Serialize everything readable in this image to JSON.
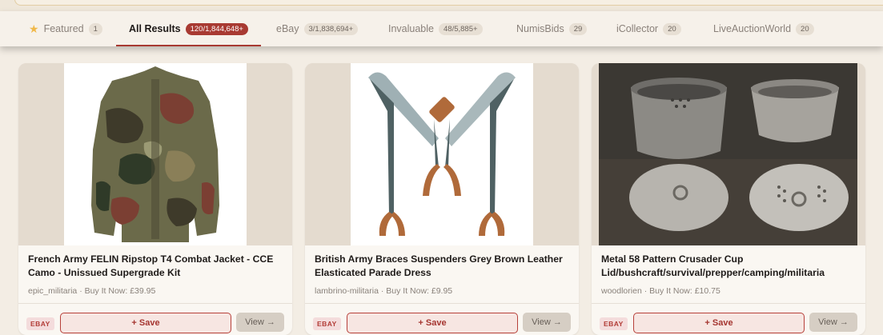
{
  "tabs": [
    {
      "label": "Featured",
      "count": "1",
      "active": false,
      "icon": "star-icon"
    },
    {
      "label": "All Results",
      "count": "120/1,844,648+",
      "active": true
    },
    {
      "label": "eBay",
      "count": "3/1,838,694+",
      "active": false
    },
    {
      "label": "Invaluable",
      "count": "48/5,885+",
      "active": false
    },
    {
      "label": "NumisBids",
      "count": "29",
      "active": false
    },
    {
      "label": "iCollector",
      "count": "20",
      "active": false
    },
    {
      "label": "LiveAuctionWorld",
      "count": "20",
      "active": false
    }
  ],
  "listings": [
    {
      "title": "French Army FELIN Ripstop T4 Combat Jacket - CCE Camo - Unissued Supergrade Kit",
      "meta": "epic_militaria · Buy It Now: £39.95",
      "source": "EBAY",
      "save_label": "+ Save",
      "view_label": "View →",
      "image": "camo-jacket-image"
    },
    {
      "title": "British Army Braces Suspenders Grey Brown Leather Elasticated Parade Dress",
      "meta": "lambrino-militaria · Buy It Now: £9.95",
      "source": "EBAY",
      "save_label": "+ Save",
      "view_label": "View →",
      "image": "braces-suspenders-image"
    },
    {
      "title": "Metal 58 Pattern Crusader Cup Lid/bushcraft/survival/prepper/camping/militaria",
      "meta": "woodlorien · Buy It Now: £10.75",
      "source": "EBAY",
      "save_label": "+ Save",
      "view_label": "View →",
      "image": "crusader-cup-image"
    }
  ],
  "colors": {
    "accent": "#a83a32",
    "background": "#f3ede4"
  }
}
